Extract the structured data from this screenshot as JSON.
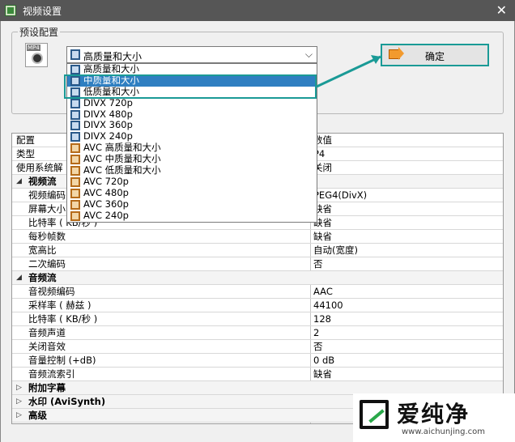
{
  "window": {
    "title": "视频设置",
    "close": "✕"
  },
  "preset": {
    "group_label": "预设配置",
    "icon_tag": "MP4",
    "selected": "高质量和大小",
    "arrow": "⌵",
    "ok_label": "确定",
    "options": [
      {
        "label": "高质量和大小",
        "icon": "blue"
      },
      {
        "label": "中质量和大小",
        "icon": "blue",
        "selected": true
      },
      {
        "label": "低质量和大小",
        "icon": "blue"
      },
      {
        "label": "DIVX 720p",
        "icon": "blue"
      },
      {
        "label": "DIVX 480p",
        "icon": "blue"
      },
      {
        "label": "DIVX 360p",
        "icon": "blue"
      },
      {
        "label": "DIVX 240p",
        "icon": "blue"
      },
      {
        "label": "AVC 高质量和大小",
        "icon": "orange"
      },
      {
        "label": "AVC 中质量和大小",
        "icon": "orange"
      },
      {
        "label": "AVC 低质量和大小",
        "icon": "orange"
      },
      {
        "label": "AVC 720p",
        "icon": "orange"
      },
      {
        "label": "AVC 480p",
        "icon": "orange"
      },
      {
        "label": "AVC 360p",
        "icon": "orange"
      },
      {
        "label": "AVC 240p",
        "icon": "orange"
      }
    ]
  },
  "properties": {
    "header": {
      "name": "配置",
      "value": "数值"
    },
    "rows": [
      {
        "kind": "plain",
        "name": "类型",
        "value": "P4"
      },
      {
        "kind": "plain",
        "name": "使用系统解",
        "value": "关闭"
      },
      {
        "kind": "cat",
        "name": "视频流",
        "tri": "◢"
      },
      {
        "kind": "item",
        "name": "视频编码",
        "value": "PEG4(DivX)"
      },
      {
        "kind": "item",
        "name": "屏幕大小",
        "value": "缺省"
      },
      {
        "kind": "item",
        "name": "比特率 ( KB/秒 )",
        "value": "缺省"
      },
      {
        "kind": "item",
        "name": "每秒帧数",
        "value": "缺省"
      },
      {
        "kind": "item",
        "name": "宽高比",
        "value": "自动(宽度)"
      },
      {
        "kind": "item",
        "name": "二次编码",
        "value": "否"
      },
      {
        "kind": "cat",
        "name": "音频流",
        "tri": "◢"
      },
      {
        "kind": "item",
        "name": "音视频编码",
        "value": "AAC"
      },
      {
        "kind": "item",
        "name": "采样率 ( 赫兹 )",
        "value": "44100"
      },
      {
        "kind": "item",
        "name": "比特率 ( KB/秒 )",
        "value": "128"
      },
      {
        "kind": "item",
        "name": "音频声道",
        "value": "2"
      },
      {
        "kind": "item",
        "name": "关闭音效",
        "value": "否"
      },
      {
        "kind": "item",
        "name": "音量控制 (+dB)",
        "value": "0 dB"
      },
      {
        "kind": "item",
        "name": "音频流索引",
        "value": "缺省"
      },
      {
        "kind": "cat",
        "name": "附加字幕",
        "tri": "▷"
      },
      {
        "kind": "cat",
        "name": "水印 (AviSynth)",
        "tri": "▷"
      },
      {
        "kind": "cat",
        "name": "高级",
        "tri": "▷"
      }
    ]
  },
  "watermark": {
    "brand": "爱纯净",
    "url": "www.aichunjing.com"
  },
  "colors": {
    "accent": "#1a9a96",
    "selection": "#2f7fc1",
    "titlebar": "#565656"
  }
}
